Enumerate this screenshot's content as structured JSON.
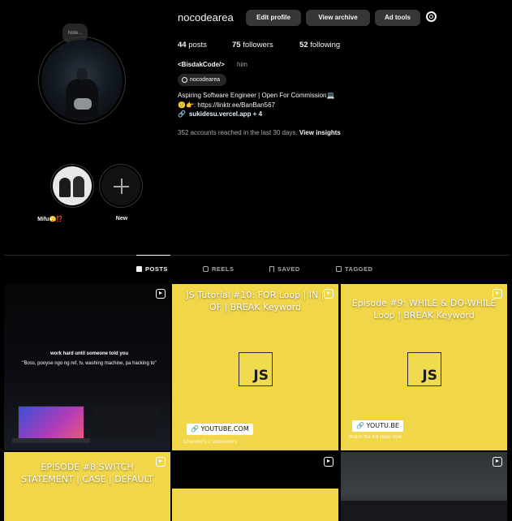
{
  "profile": {
    "note": "Note...",
    "username": "nocodearea",
    "buttons": {
      "edit": "Edit profile",
      "archive": "View archive",
      "ad_tools": "Ad tools"
    },
    "stats": {
      "posts_count": "44",
      "posts_label": "posts",
      "followers_count": "75",
      "followers_label": "followers",
      "following_count": "52",
      "following_label": "following"
    },
    "full_name": "<BisdakCode/>",
    "pronoun": "him",
    "threads_handle": "nocodearea",
    "bio_line1": "Aspiring Software Engineer | Open For Commission💻",
    "bio_line2": "🙂👉: https://linktr.ee/BanBan567",
    "link_text": "sukidesu.vercel.app + 4",
    "reach_text": "352 accounts reached in the last 30 days.",
    "reach_link": "View insights"
  },
  "highlights": [
    {
      "label": "Mifu🫣⁉️"
    },
    {
      "label": "New"
    }
  ],
  "tabs": [
    {
      "label": "POSTS",
      "active": true
    },
    {
      "label": "REELS",
      "active": false
    },
    {
      "label": "SAVED",
      "active": false
    },
    {
      "label": "TAGGED",
      "active": false
    }
  ],
  "posts": [
    {
      "kind": "photo",
      "text1": "work hard until someone told you",
      "text2": "\"Boss, pooyse ngo ng ref, tv, washing machine, pa hacking to\""
    },
    {
      "kind": "tutorial",
      "title": "JS Tutorial #10: FOR Loop | IN | OF | BREAK Keyword",
      "logo": "JS",
      "badge": "🔗 YOUTUBE.COM",
      "sub": "Chandler's 1 subscribers"
    },
    {
      "kind": "tutorial",
      "title": "Episode #9: WHILE & DO-WHILE Loop | BREAK Keyword",
      "logo": "JS",
      "badge": "🔗 YOUTU.BE",
      "sub": "Watch the full video now"
    },
    {
      "kind": "tutorial",
      "title": "EPISODE #8 SWITCH STATEMENT | CASE | DEFAULT"
    },
    {
      "kind": "tutorial-partial"
    },
    {
      "kind": "photo-gray"
    }
  ],
  "colors": {
    "background": "#000000",
    "button_bg": "#363636",
    "muted_text": "#a8a8a8",
    "post_yellow": "#f2d649",
    "link_color": "#e0f1ff"
  },
  "icons": [
    "gear-icon",
    "threads-icon",
    "link-icon",
    "plus-icon",
    "grid-icon",
    "reels-icon",
    "bookmark-icon",
    "tag-icon",
    "reel-badge-icon"
  ]
}
